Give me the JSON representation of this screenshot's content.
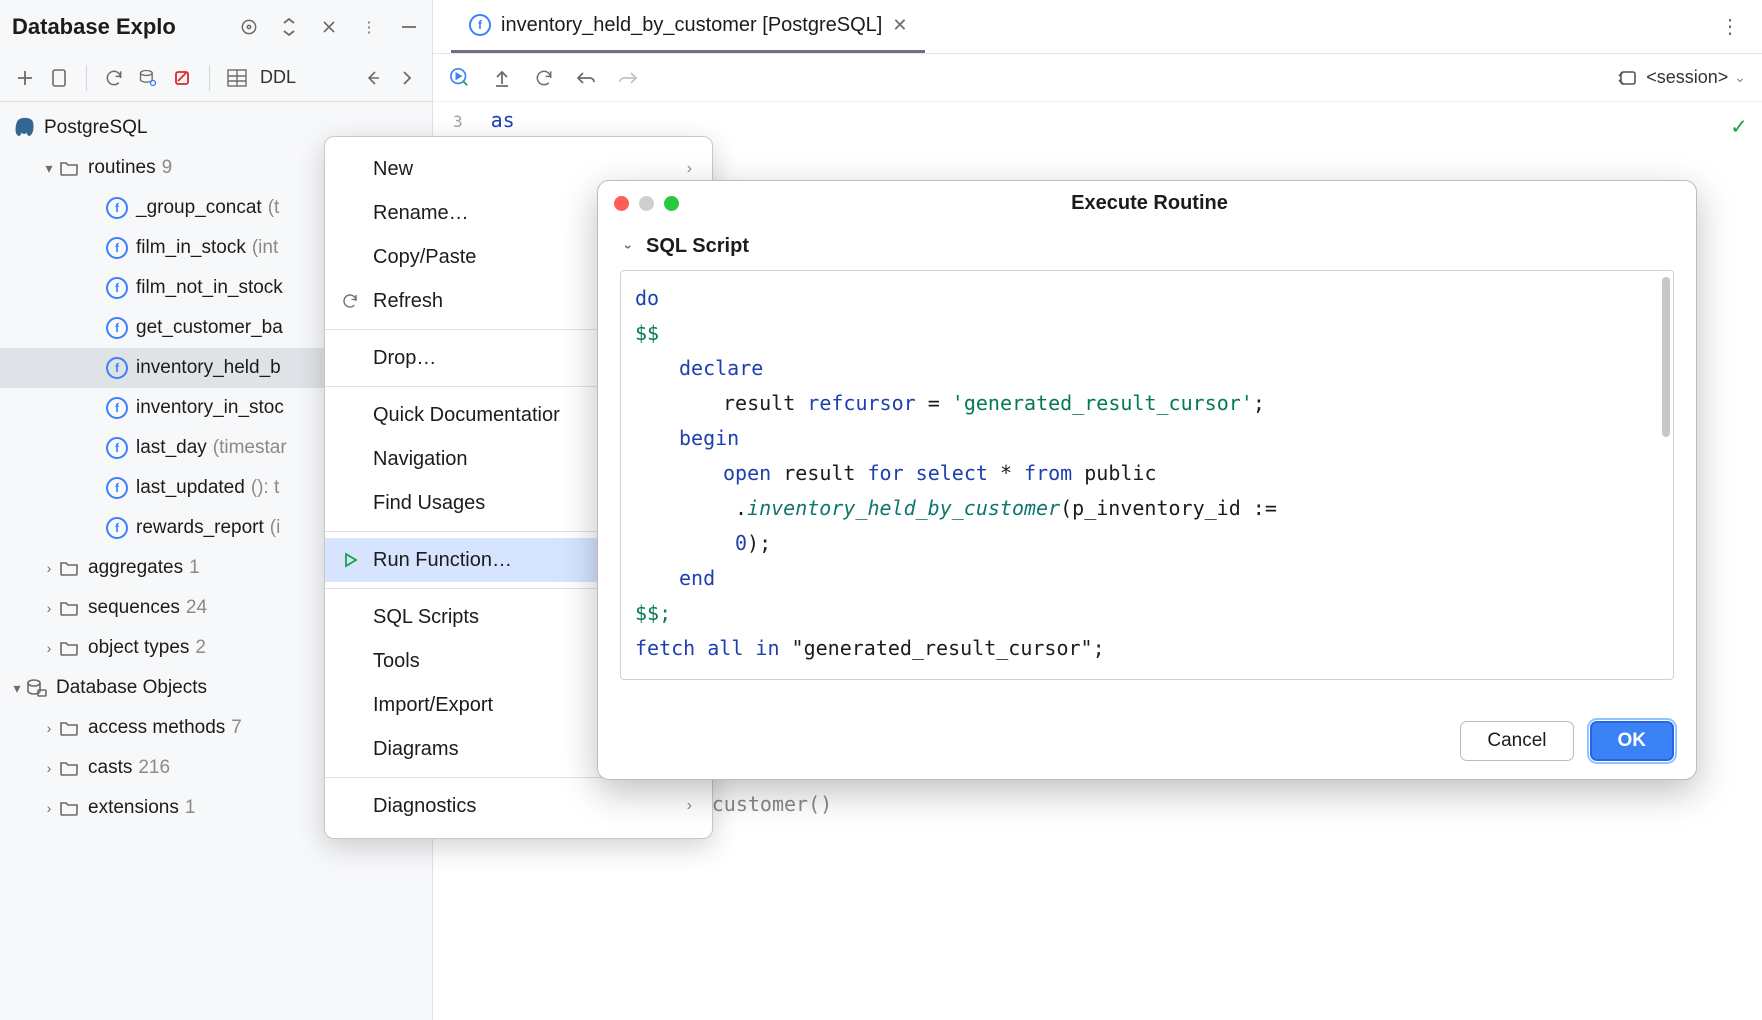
{
  "sidebar": {
    "title": "Database Explo",
    "ddl_label": "DDL",
    "datasource": "PostgreSQL",
    "routines": {
      "label": "routines",
      "count": "9",
      "items": [
        {
          "name": "_group_concat",
          "sig": "(t"
        },
        {
          "name": "film_in_stock",
          "sig": "(int"
        },
        {
          "name": "film_not_in_stock",
          "sig": ""
        },
        {
          "name": "get_customer_ba",
          "sig": ""
        },
        {
          "name": "inventory_held_b",
          "sig": ""
        },
        {
          "name": "inventory_in_stoc",
          "sig": ""
        },
        {
          "name": "last_day",
          "sig": "(timestar"
        },
        {
          "name": "last_updated",
          "sig": "(): t"
        },
        {
          "name": "rewards_report",
          "sig": "(i"
        }
      ]
    },
    "folders": [
      {
        "label": "aggregates",
        "count": "1"
      },
      {
        "label": "sequences",
        "count": "24"
      },
      {
        "label": "object types",
        "count": "2"
      }
    ],
    "db_objects": {
      "label": "Database Objects",
      "items": [
        {
          "label": "access methods",
          "count": "7"
        },
        {
          "label": "casts",
          "count": "216"
        },
        {
          "label": "extensions",
          "count": "1"
        }
      ]
    }
  },
  "editor": {
    "tab_title": "inventory_held_by_customer [PostgreSQL]",
    "session_label": "<session>",
    "line3_num": "3",
    "line3_kw": "as",
    "bottom_hint": "inventory_held_by_customer()"
  },
  "context_menu": {
    "new": "New",
    "rename": "Rename…",
    "copypaste": "Copy/Paste",
    "refresh": "Refresh",
    "drop": "Drop…",
    "quickdoc": "Quick Documentatior",
    "navigation": "Navigation",
    "findusages": "Find Usages",
    "runfn": "Run Function…",
    "sqlscripts": "SQL Scripts",
    "tools": "Tools",
    "importexport": "Import/Export",
    "diagrams": "Diagrams",
    "diagnostics": "Diagnostics"
  },
  "dialog": {
    "title": "Execute Routine",
    "section": "SQL Script",
    "script": {
      "l1": "do",
      "l2": "$$",
      "l3a": "declare",
      "l4a": "result ",
      "l4b": "refcursor",
      "l4c": " = ",
      "l4d": "'generated_result_cursor'",
      "l4e": ";",
      "l5": "begin",
      "l6a": "open",
      "l6b": " result ",
      "l6c": "for select",
      "l6d": " * ",
      "l6e": "from",
      "l6f": " public",
      "l7a": ".",
      "l7b": "inventory_held_by_customer",
      "l7c": "(p_inventory_id := ",
      "l8a": "0",
      "l8b": ");",
      "l9": "end",
      "l10": "$$;",
      "l11a": "fetch all in",
      "l11b": " \"generated_result_cursor\";"
    },
    "cancel": "Cancel",
    "ok": "OK"
  }
}
